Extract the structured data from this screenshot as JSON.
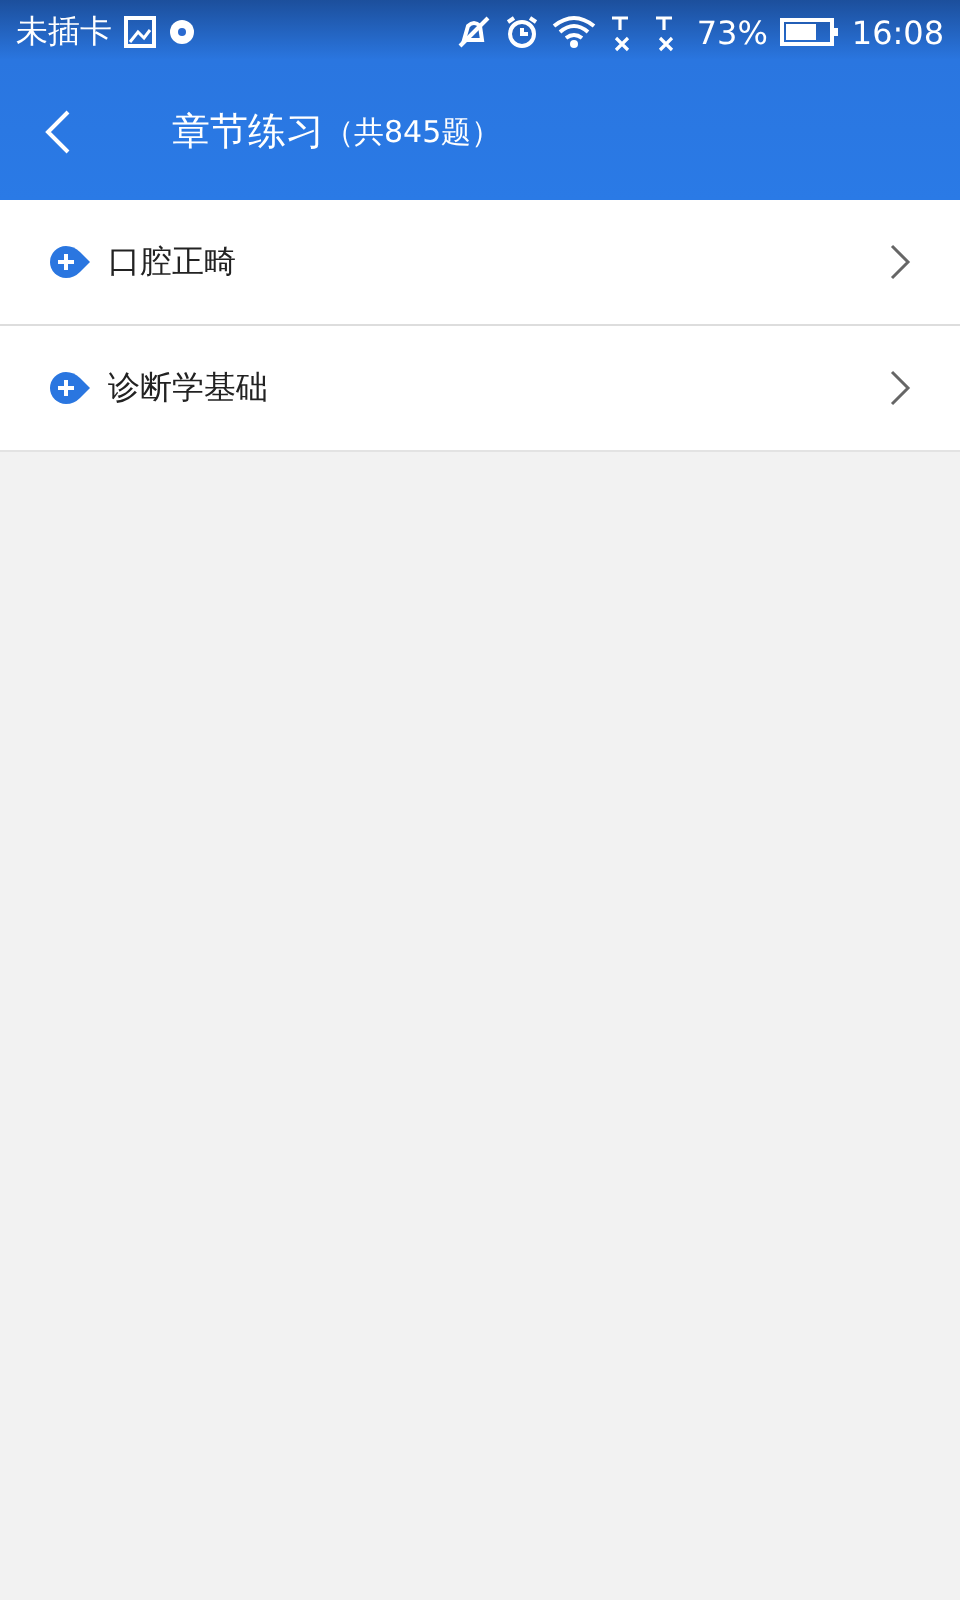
{
  "status_bar": {
    "carrier": "未插卡",
    "battery": "73%",
    "time": "16:08"
  },
  "header": {
    "title": "章节练习",
    "count": "（共845题）"
  },
  "chapters": [
    {
      "label": "口腔正畸",
      "expanded": false
    },
    {
      "label": "诊断学基础",
      "expanded": false
    }
  ]
}
